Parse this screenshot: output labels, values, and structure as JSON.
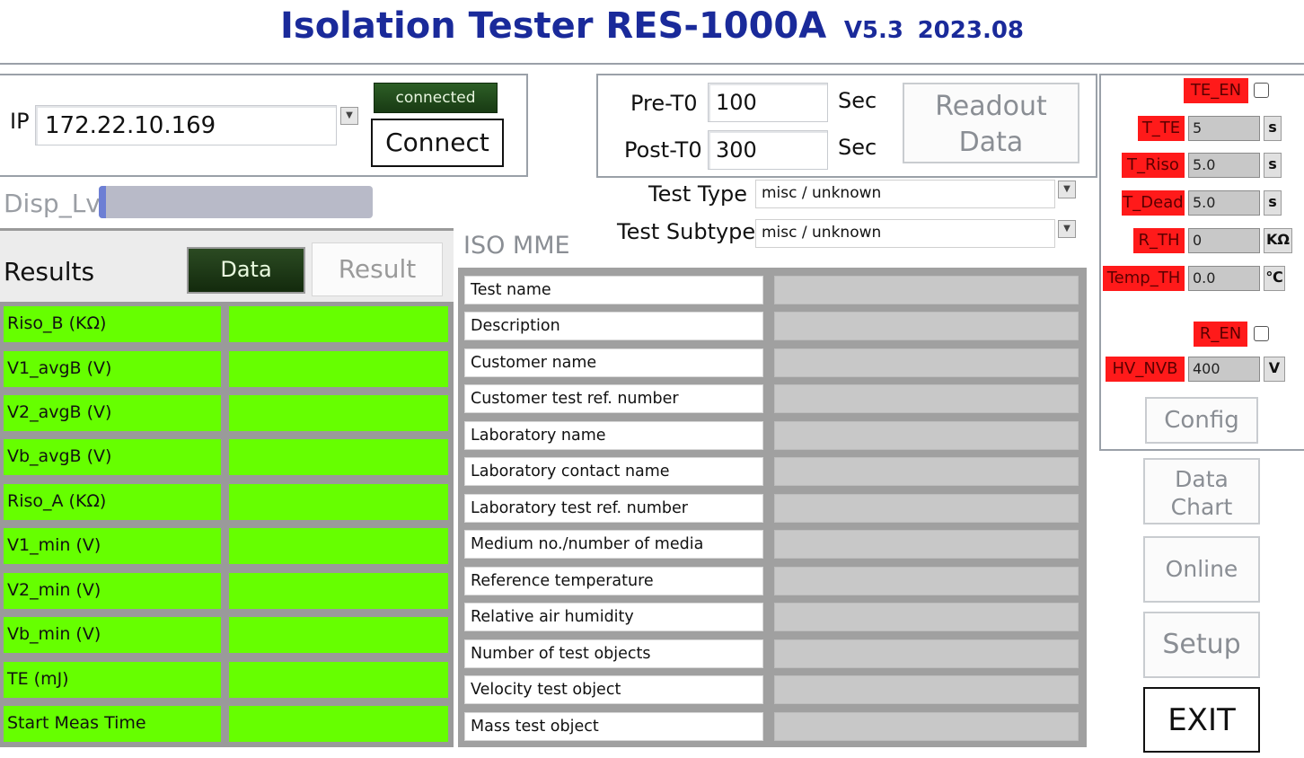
{
  "header": {
    "title": "Isolation Tester RES-1000A",
    "version": "V5.3",
    "date": "2023.08"
  },
  "connection": {
    "ip_label": "IP",
    "ip_value": "172.22.10.169",
    "status": "connected",
    "connect_label": "Connect"
  },
  "timing": {
    "pre_label": "Pre-T0",
    "pre_value": "100",
    "post_label": "Post-T0",
    "post_value": "300",
    "unit": "Sec",
    "readout_label_1": "Readout",
    "readout_label_2": "Data"
  },
  "display": {
    "disp_label": "Disp_Lv"
  },
  "test_type": {
    "type_label": "Test Type",
    "type_value": "misc / unknown",
    "subtype_label": "Test Subtype",
    "subtype_value": "misc / unknown"
  },
  "results": {
    "title": "Results",
    "tab_data": "Data",
    "tab_result": "Result",
    "rows": [
      "Riso_B  (KΩ)",
      "V1_avgB  (V)",
      "V2_avgB  (V)",
      "Vb_avgB  (V)",
      "Riso_A  (KΩ)",
      "V1_min  (V)",
      "V2_min  (V)",
      "Vb_min  (V)",
      "TE  (mJ)",
      "Start Meas Time"
    ]
  },
  "iso_mme": {
    "title": "ISO MME",
    "fields": [
      "Test name",
      "Description",
      "Customer name",
      "Customer test ref. number",
      "Laboratory name",
      "Laboratory contact name",
      "Laboratory test ref. number",
      "Medium no./number of media",
      "Reference temperature",
      "Relative air humidity",
      "Number of test objects",
      "Velocity test object",
      "Mass test object"
    ]
  },
  "settings": {
    "te_en": "TE_EN",
    "t_te_label": "T_TE",
    "t_te_value": "5",
    "t_riso_label": "T_Riso",
    "t_riso_value": "5.0",
    "t_dead_label": "T_Dead",
    "t_dead_value": "5.0",
    "r_th_label": "R_TH",
    "r_th_value": "0",
    "temp_th_label": "Temp_TH",
    "temp_th_value": "0.0",
    "r_en": "R_EN",
    "hv_nvb_label": "HV_NVB",
    "hv_nvb_value": "400",
    "unit_s": "s",
    "unit_kohm": "KΩ",
    "unit_c": "℃",
    "unit_v": "V",
    "config_label": "Config"
  },
  "side_buttons": {
    "data_chart_1": "Data",
    "data_chart_2": "Chart",
    "online": "Online",
    "setup": "Setup",
    "exit": "EXIT"
  },
  "colors": {
    "title_blue": "#1a2a9a",
    "result_green": "#66ff00",
    "setting_red": "#ff1a1a"
  }
}
